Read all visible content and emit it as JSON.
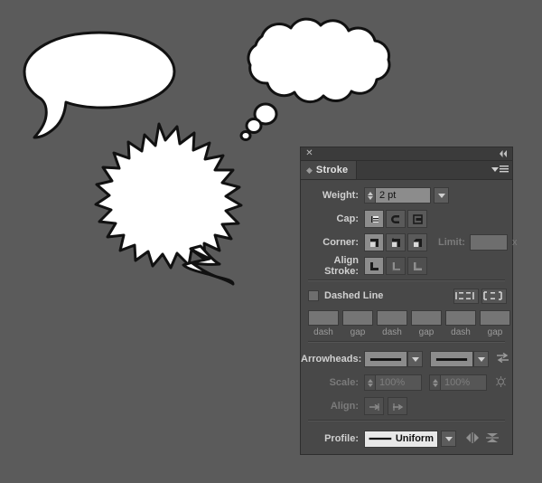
{
  "app": {
    "background_color": "#5b5b5b",
    "panel_bg": "#484848",
    "panel_header_bg": "#3b3b3b"
  },
  "artwork": {
    "shapes": [
      {
        "name": "oval-speech-bubble",
        "fill": "#ffffff",
        "stroke": "#000000"
      },
      {
        "name": "cloud-thought-bubble",
        "fill": "#ffffff",
        "stroke": "#000000"
      },
      {
        "name": "starburst-speech-bubble",
        "fill": "#ffffff",
        "stroke": "#000000"
      }
    ]
  },
  "panel": {
    "title": "Stroke",
    "close_label": "✕",
    "collapse_label": "«",
    "menu_label": "≡",
    "weight": {
      "label": "Weight:",
      "value": "2 pt",
      "placeholder": "2 pt"
    },
    "cap": {
      "label": "Cap:",
      "options": [
        "Butt Cap",
        "Round Cap",
        "Projecting Cap"
      ],
      "selected_index": 0
    },
    "corner": {
      "label": "Corner:",
      "options": [
        "Miter Join",
        "Round Join",
        "Bevel Join"
      ],
      "selected_index": 0,
      "limit_label": "Limit:",
      "limit_value": "",
      "limit_unit": "x"
    },
    "align_stroke": {
      "label": "Align Stroke:",
      "options": [
        "Align Stroke to Center",
        "Align Stroke to Inside",
        "Align Stroke to Outside"
      ],
      "selected_index": 0
    },
    "dashed_line": {
      "label": "Dashed Line",
      "checked": false,
      "align_options": [
        "Preserves exact dash and gap lengths",
        "Aligns dashes to corners and path ends"
      ],
      "fields": [
        {
          "caption": "dash",
          "value": ""
        },
        {
          "caption": "gap",
          "value": ""
        },
        {
          "caption": "dash",
          "value": ""
        },
        {
          "caption": "gap",
          "value": ""
        },
        {
          "caption": "dash",
          "value": ""
        },
        {
          "caption": "gap",
          "value": ""
        }
      ]
    },
    "arrowheads": {
      "label": "Arrowheads:",
      "start_value": "None",
      "end_value": "None",
      "swap_label": "Swap start and end arrowheads"
    },
    "scale": {
      "label": "Scale:",
      "start_value": "100%",
      "end_value": "100%",
      "link_label": "Link arrowhead scales"
    },
    "align": {
      "label": "Align:",
      "options": [
        "Extend arrow tip beyond end of path",
        "Place arrow tip at end of path"
      ]
    },
    "profile": {
      "label": "Profile:",
      "value": "Uniform",
      "flip_across_label": "Flip Across",
      "flip_along_label": "Flip Along"
    }
  }
}
